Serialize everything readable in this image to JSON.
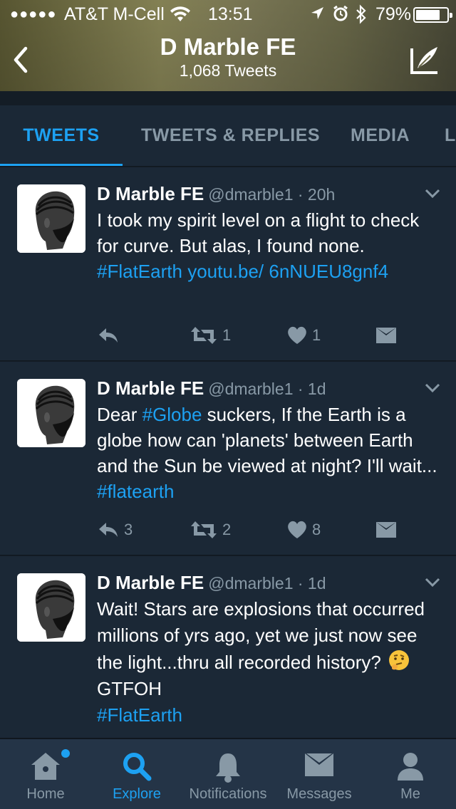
{
  "status_bar": {
    "signal": "●●●●●",
    "carrier": "AT&T M-Cell",
    "time": "13:51",
    "battery_percent": "79%",
    "battery_level": 0.79
  },
  "header": {
    "title": "D Marble FE",
    "subtitle": "1,068 Tweets",
    "back_icon": "chevron-left-icon",
    "compose_icon": "compose-quill-icon"
  },
  "tabs": [
    {
      "label": "TWEETS",
      "active": true
    },
    {
      "label": "TWEETS & REPLIES",
      "active": false
    },
    {
      "label": "MEDIA",
      "active": false
    },
    {
      "label": "LIKES",
      "active": false
    }
  ],
  "tweets": [
    {
      "name": "D Marble FE",
      "handle": "@dmarble1 · 20h",
      "text_parts": [
        {
          "text": "I took my spirit level on a flight to check for curve. But alas, I found none. ",
          "link": false
        },
        {
          "text": "#FlatEarth",
          "link": true
        },
        {
          "text": " ",
          "link": false
        },
        {
          "text": "youtu.be/ 6nNUEU8gnf4",
          "link": true
        }
      ],
      "reply_count": "",
      "retweet_count": "1",
      "like_count": "1"
    },
    {
      "name": "D Marble FE",
      "handle": "@dmarble1 · 1d",
      "text_parts": [
        {
          "text": "Dear ",
          "link": false
        },
        {
          "text": "#Globe",
          "link": true
        },
        {
          "text": " suckers, If the Earth is a globe how can 'planets' between Earth and the Sun be viewed at night? I'll wait... ",
          "link": false
        },
        {
          "text": "#flatearth",
          "link": true
        }
      ],
      "reply_count": "3",
      "retweet_count": "2",
      "like_count": "8"
    },
    {
      "name": "D Marble FE",
      "handle": "@dmarble1 · 1d",
      "text_parts": [
        {
          "text": "Wait! Stars are explosions that occurred millions of yrs ago, yet we just now see the light...thru all recorded history? ",
          "link": false
        },
        {
          "text": "GTFOH",
          "link": false
        },
        {
          "text": "#FlatEarth",
          "link": true
        }
      ],
      "emoji": "thinking-face-emoji",
      "reply_count": "",
      "retweet_count": "",
      "like_count": ""
    }
  ],
  "tabbar": {
    "home": "Home",
    "explore": "Explore",
    "notifications": "Notifications",
    "messages": "Messages",
    "me": "Me",
    "active": "explore"
  },
  "colors": {
    "accent": "#1da1f2",
    "background": "#141d26",
    "card": "#1b2836",
    "muted": "#8899a6"
  }
}
